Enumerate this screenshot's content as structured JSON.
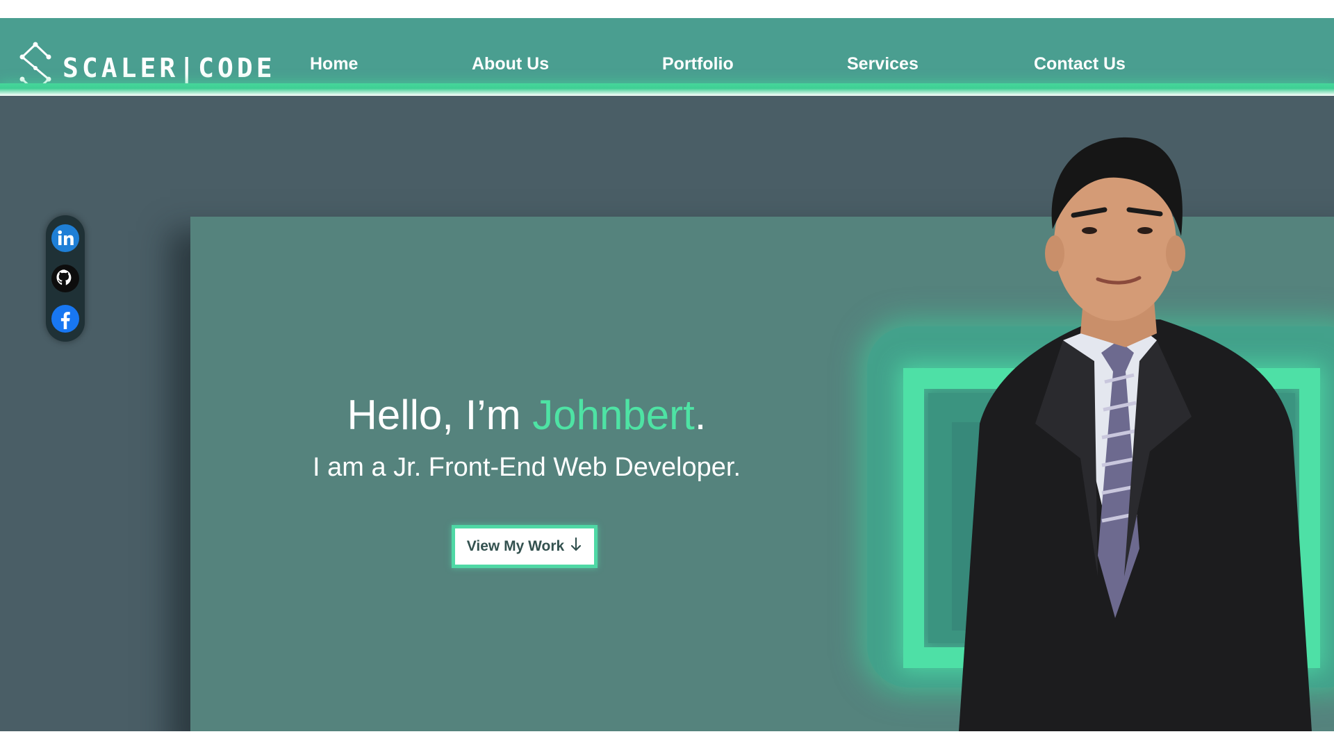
{
  "brand": {
    "name": "SCALER|CODE",
    "logo_icon": "s-circuit-logo-icon"
  },
  "nav": {
    "items": [
      {
        "label": "Home"
      },
      {
        "label": "About Us"
      },
      {
        "label": "Portfolio"
      },
      {
        "label": "Services"
      },
      {
        "label": "Contact Us"
      }
    ]
  },
  "social": {
    "items": [
      {
        "name": "linkedin",
        "icon": "linkedin-icon"
      },
      {
        "name": "github",
        "icon": "github-icon"
      },
      {
        "name": "facebook",
        "icon": "facebook-icon"
      }
    ]
  },
  "hero": {
    "greeting_prefix": "Hello, I’m ",
    "name": "Johnbert",
    "greeting_suffix": ".",
    "subtitle": "I am a Jr. Front-End Web Developer.",
    "cta_label": "View My Work",
    "cta_icon": "arrow-down-icon",
    "portrait_alt": "portrait-photo"
  },
  "colors": {
    "header": "#4a9e90",
    "accent": "#4ee3a4",
    "hero_background": "#4a5e66",
    "hero_panel": "#55837d"
  }
}
